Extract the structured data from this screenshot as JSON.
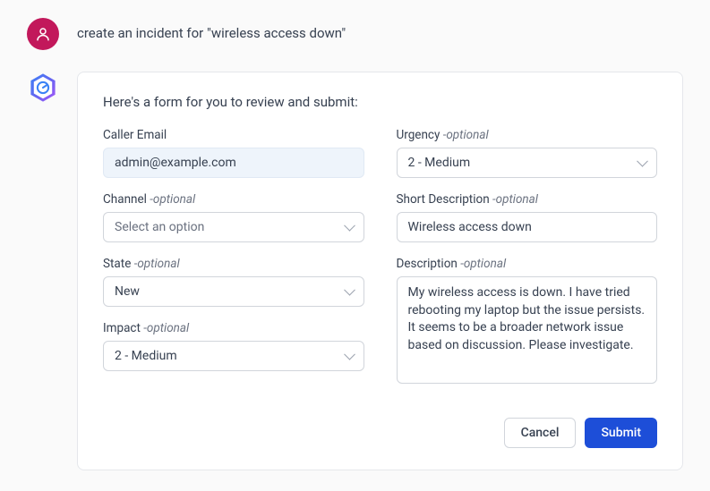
{
  "user": {
    "message": "create an incident for \"wireless access down\""
  },
  "assistant": {
    "intro": "Here's a form for you to review and submit:",
    "form": {
      "caller_email": {
        "label": "Caller Email",
        "value": "admin@example.com"
      },
      "channel": {
        "label": "Channel",
        "optional": "-optional",
        "placeholder": "Select an option"
      },
      "state": {
        "label": "State",
        "optional": "-optional",
        "value": "New"
      },
      "impact": {
        "label": "Impact",
        "optional": "-optional",
        "value": "2 - Medium"
      },
      "urgency": {
        "label": "Urgency",
        "optional": "-optional",
        "value": "2 - Medium"
      },
      "short_description": {
        "label": "Short Description",
        "optional": "-optional",
        "value": "Wireless access down"
      },
      "description": {
        "label": "Description",
        "optional": "-optional",
        "value": "My wireless access is down. I have tried rebooting my laptop but the issue persists. It seems to be a broader network issue based on discussion. Please investigate."
      }
    },
    "actions": {
      "cancel": "Cancel",
      "submit": "Submit"
    }
  }
}
